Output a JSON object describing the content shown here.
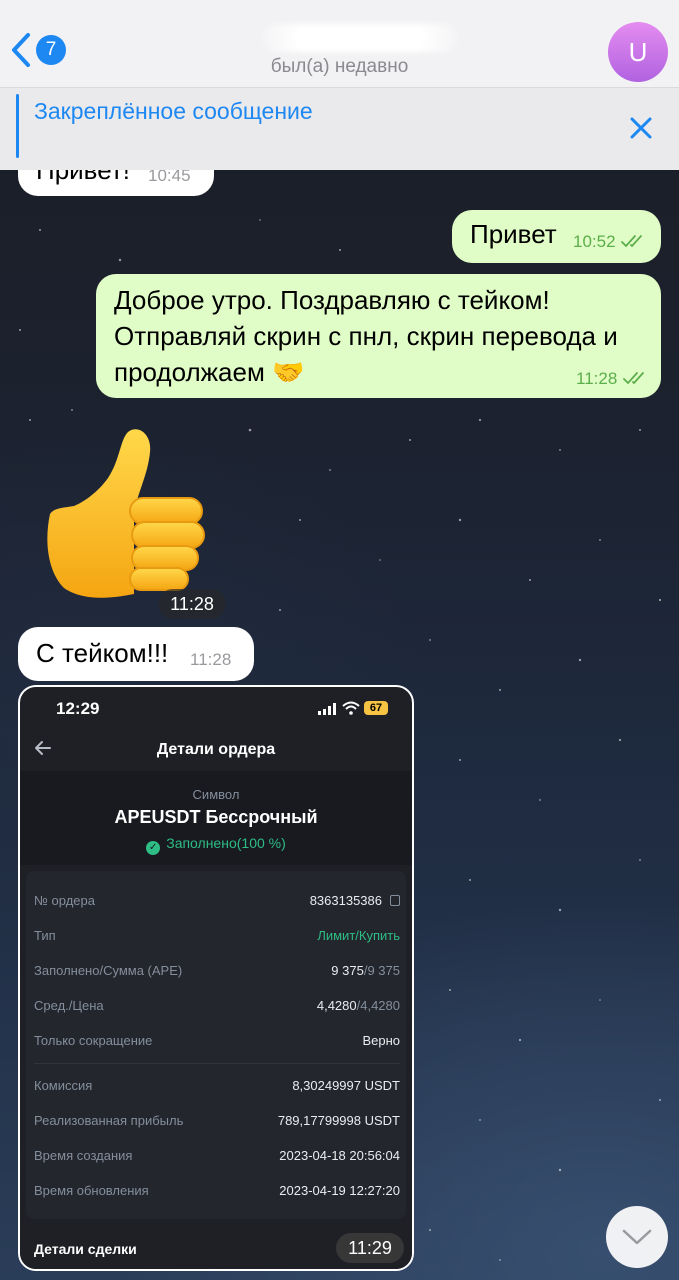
{
  "header": {
    "back_badge_count": "7",
    "chat_status": "был(а) недавно",
    "avatar_letter": "U"
  },
  "pinned": {
    "title": "Закреплённое сообщение"
  },
  "messages": [
    {
      "text": "Привет!",
      "time": "10:45",
      "direction": "in"
    },
    {
      "text": "Привет",
      "time": "10:52",
      "direction": "out"
    },
    {
      "text": "Доброе утро. Поздравляю с тейком! Отправляй скрин с пнл, скрин перевода и продолжаем 🤝",
      "time": "11:28",
      "direction": "out"
    },
    {
      "sticker": "thumbs-up",
      "time": "11:28",
      "direction": "in"
    },
    {
      "text": "С тейком!!!",
      "time": "11:28",
      "direction": "in"
    }
  ],
  "screenshot": {
    "status_time": "12:29",
    "battery": "67",
    "title": "Детали ордера",
    "symbol_label": "Символ",
    "symbol": "APEUSDT Бессрочный",
    "filled_status": "Заполнено(100 %)",
    "rows": [
      {
        "label": "№ ордера",
        "value": "8363135386"
      },
      {
        "label": "Тип",
        "value": "Лимит/Купить"
      },
      {
        "label": "Заполнено/Сумма (APE)",
        "value_main": "9 375",
        "value_dim": "/9 375"
      },
      {
        "label": "Сред./Цена",
        "value_main": "4,4280",
        "value_dim": "/4,4280"
      },
      {
        "label": "Только сокращение",
        "value": "Верно"
      },
      {
        "label": "Комиссия",
        "value": "8,30249997 USDT"
      },
      {
        "label": "Реализованная прибыль",
        "value": "789,17799998 USDT"
      },
      {
        "label": "Время создания",
        "value": "2023-04-18 20:56:04"
      },
      {
        "label": "Время обновления",
        "value": "2023-04-19 12:27:20"
      }
    ],
    "deals_label": "Детали сделки",
    "message_time": "11:29"
  },
  "colors": {
    "accent": "#1e88f2",
    "outgoing_bubble": "#e1fdc7",
    "incoming_bubble": "#ffffff",
    "binance_green": "#2ebd85",
    "avatar": "#c97ae8"
  }
}
